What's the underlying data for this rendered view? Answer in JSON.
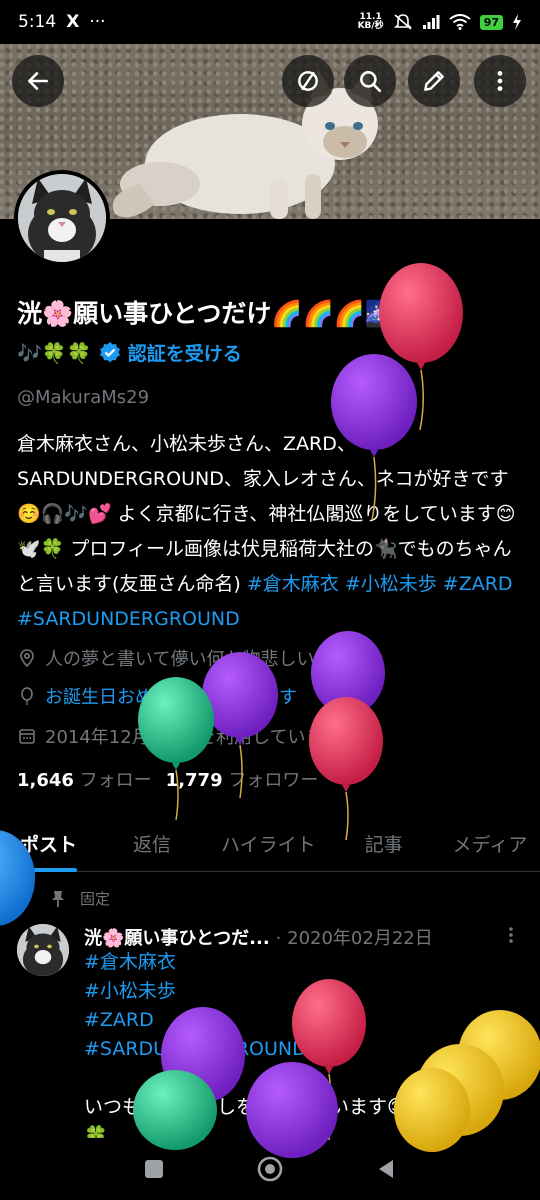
{
  "status_bar": {
    "time": "5:14",
    "x_icon": "X",
    "dots": "···",
    "net_speed_value": "11.1",
    "net_speed_unit": "KB/秒",
    "battery": "97"
  },
  "profile": {
    "display_name": "洸🌸願い事ひとつだけ🌈🌈🌈🌌🦉",
    "name_line2_emojis": "🎶🍀🍀",
    "verify_label": "認証を受ける",
    "handle": "@MakuraMs29",
    "bio_text": "倉木麻衣さん、小松未歩さん、ZARD、SARDUNDERGROUND、家入レオさん、ネコが好きです☺️🎧🎶💕 よく京都に行き、神社仏閣巡りをしています😊🕊️🍀 プロフィール画像は伏見稲荷大社の🐈‍⬛でものちゃんと言います(友亜さん命名) ",
    "bio_tags": "#倉木麻衣 #小松未歩 #ZARD #SARDUNDERGROUND",
    "location": "人の夢と書いて儚い何か物悲しいわね…。",
    "birthday": "お誕生日おめでとうございます",
    "joined": "2014年12月からXを利用しています",
    "following_count": "1,646",
    "following_label": "フォロー",
    "followers_count": "1,779",
    "followers_label": "フォロワー"
  },
  "tabs": [
    "ポスト",
    "返信",
    "ハイライト",
    "記事",
    "メディア"
  ],
  "post": {
    "pinned_label": "固定",
    "author": "洸🌸願い事ひとつだ...",
    "date": "· 2020年02月22日",
    "tags": [
      "#倉木麻衣",
      "#小松未歩",
      "#ZARD",
      "#SARDUNDERGROUND"
    ],
    "text": "いつも元気と癒しをもらっています😊",
    "emoji_line": "🍀"
  },
  "icons": {
    "back": "back-arrow-icon",
    "mute": "circle-slash-icon",
    "search": "search-icon",
    "edit": "pencil-icon",
    "more": "more-vertical-icon",
    "verified": "verified-badge-icon",
    "location": "location-pin-icon",
    "birthday": "balloon-icon",
    "calendar": "calendar-icon",
    "pin": "pin-icon"
  },
  "colors": {
    "accent": "#1d9bf0",
    "secondary_text": "#71767b",
    "background": "#000000"
  }
}
